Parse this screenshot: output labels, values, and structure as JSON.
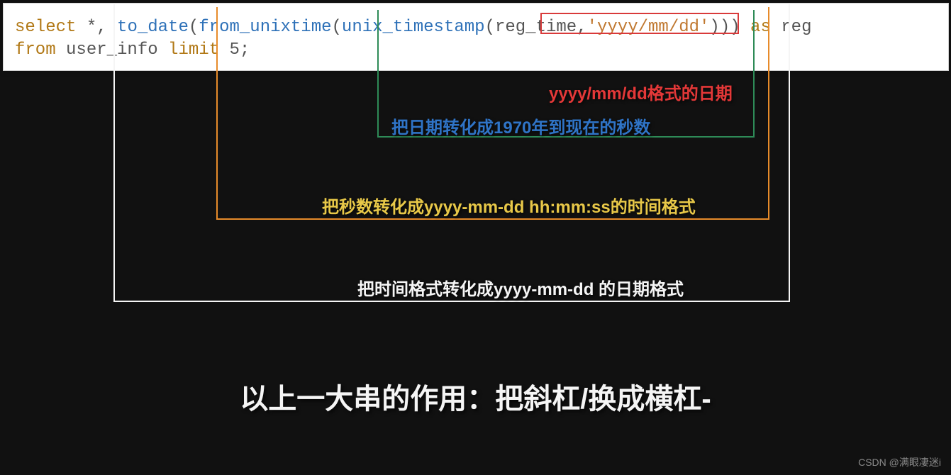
{
  "code": {
    "tokens": {
      "select": "select",
      "star": "*",
      "comma": ",",
      "to_date": "to_date",
      "lp": "(",
      "from_unixtime": "from_unixtime",
      "unix_timestamp": "unix_timestamp",
      "reg_time": "reg_time",
      "fmt_str": "'yyyy/mm/dd'",
      "rp": ")",
      "as": "as",
      "reg": "reg",
      "from": "from",
      "user_info": "user_info",
      "limit": "limit",
      "five": "5",
      "semi": ";"
    }
  },
  "annotations": {
    "red": "yyyy/mm/dd格式的日期",
    "blue": "把日期转化成1970年到现在的秒数",
    "yellow": "把秒数转化成yyyy-mm-dd hh:mm:ss的时间格式",
    "white": "把时间格式转化成yyyy-mm-dd 的日期格式"
  },
  "conclusion": "以上一大串的作用：把斜杠/换成横杠-",
  "watermark": "CSDN @满眼凄迷i"
}
